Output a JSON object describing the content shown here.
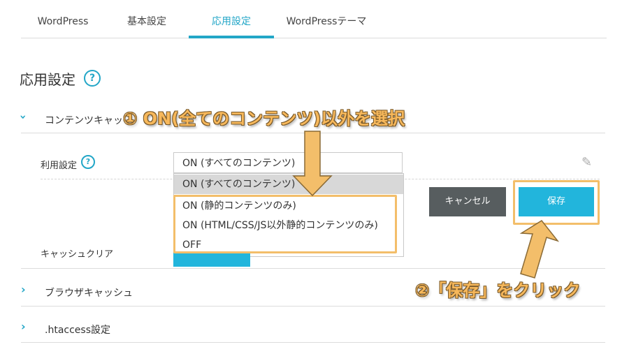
{
  "tabs": [
    {
      "label": "WordPress"
    },
    {
      "label": "基本設定"
    },
    {
      "label": "応用設定"
    },
    {
      "label": "WordPressテーマ"
    }
  ],
  "active_tab": "応用設定",
  "page": {
    "title": "応用設定",
    "help": "?"
  },
  "sections": {
    "content_cache": {
      "label": "コンテンツキャッ"
    },
    "browser_cache": {
      "label": "ブラウザキャッシュ"
    },
    "htaccess": {
      "label": ".htaccess設定"
    }
  },
  "setting": {
    "label": "利用設定",
    "help": "?",
    "selected_value": "ON (すべてのコンテンツ)",
    "options": [
      "ON (すべてのコンテンツ)",
      "ON (静的コンテンツのみ)",
      "ON (HTML/CSS/JS以外静的コンテンツのみ)",
      "OFF"
    ],
    "highlighted_option": "ON (すべてのコンテンツ)"
  },
  "cache_clear": {
    "label": "キャッシュクリア"
  },
  "buttons": {
    "cancel": "キャンセル",
    "save": "保存"
  },
  "annotations": {
    "step1": "① ON(全てのコンテンツ)以外を選択",
    "step2": "②「保存」をクリック"
  },
  "colors": {
    "accent": "#22a6c7",
    "button_blue": "#22b5dc",
    "cancel_gray": "#575d5f",
    "annotation": "#f3be6a"
  }
}
